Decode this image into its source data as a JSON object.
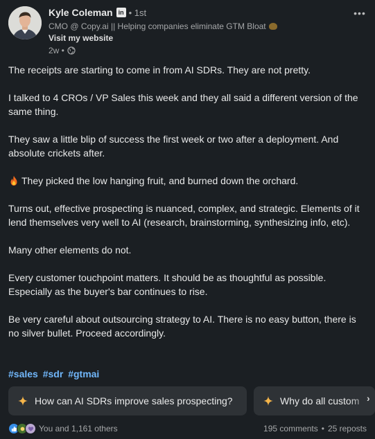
{
  "author": {
    "name": "Kyle Coleman",
    "badge": "in",
    "degree": "• 1st",
    "headline": "CMO @ Copy.ai || Helping companies eliminate GTM Bloat",
    "website_link": "Visit my website",
    "time": "2w •"
  },
  "more_icon": "•••",
  "body": {
    "p1": "The receipts are starting to come in from AI SDRs. They are not pretty.",
    "p2": "I talked to 4 CROs / VP Sales this week and they all said a different version of the same thing.",
    "p3": "They saw a little blip of success the first week or two after a deployment. And absolute crickets after.",
    "p4": "They picked the low hanging fruit, and burned down the orchard.",
    "p5": "Turns out, effective prospecting is nuanced, complex, and strategic. Elements of it lend themselves very well to AI (research, brainstorming, synthesizing info, etc).",
    "p6": "Many other elements do not.",
    "p7": "Every customer touchpoint matters. It should be as thoughtful as possible. Especially as the buyer's bar continues to rise.",
    "p8": "Be very careful about outsourcing strategy to AI. There is no easy button, there is no silver bullet. Proceed accordingly."
  },
  "hashtags": [
    "#sales",
    "#sdr",
    "#gtmai"
  ],
  "suggestions": [
    "How can AI SDRs improve sales prospecting?",
    "Why do all custom"
  ],
  "chip_scroll_icon": "›",
  "footer": {
    "reactions_label": "You and 1,161 others",
    "comments": "195 comments",
    "separator": "•",
    "reposts": "25 reposts"
  },
  "colors": {
    "background": "#1b1f23",
    "hashtag": "#71b7fb",
    "chip": "#2e3236",
    "sparkle": "#f5b54a"
  },
  "icons": [
    "linkedin-badge-icon",
    "globe-icon",
    "fire-icon",
    "sparkle-icon",
    "like-reaction-icon",
    "celebrate-reaction-icon",
    "support-reaction-icon",
    "more-options-icon",
    "chevron-right-icon"
  ]
}
